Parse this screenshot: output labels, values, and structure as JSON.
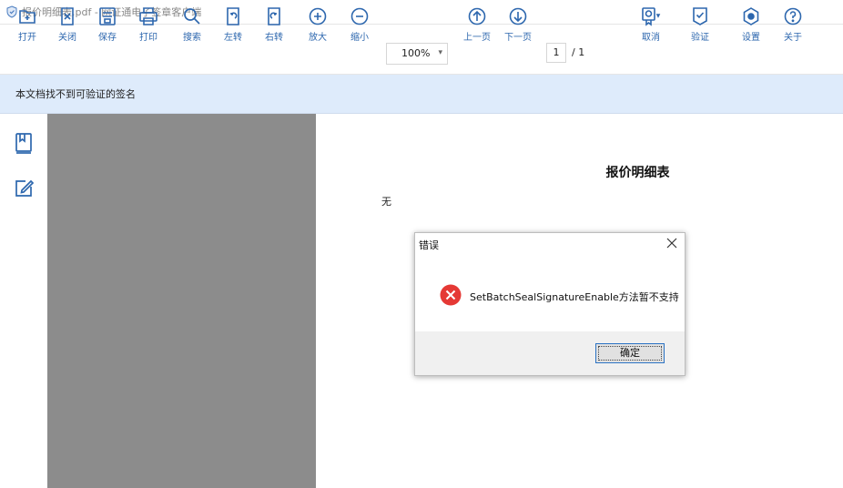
{
  "window": {
    "title": "报价明细表.pdf - 网证通电子签章客户端"
  },
  "toolbar": {
    "open": "打开",
    "close": "关闭",
    "save": "保存",
    "print": "打印",
    "search": "搜索",
    "rotate_left": "左转",
    "rotate_right": "右转",
    "zoom_in": "放大",
    "zoom_out": "缩小",
    "zoom_value": "100%",
    "prev_page": "上一页",
    "next_page": "下一页",
    "current_page": "1",
    "total_pages": "/ 1",
    "cancel": "取消",
    "verify": "验证",
    "settings": "设置",
    "about": "关于"
  },
  "signature_bar": {
    "message": "本文档找不到可验证的签名"
  },
  "document": {
    "title": "报价明细表",
    "body": "无"
  },
  "dialog": {
    "title": "错误",
    "message": "SetBatchSealSignatureEnable方法暂不支持",
    "ok_label": "确定"
  },
  "colors": {
    "accent": "#2d67ae",
    "sig_bar": "#deebfb",
    "viewer_bg": "#8c8c8c",
    "error": "#e53935"
  }
}
